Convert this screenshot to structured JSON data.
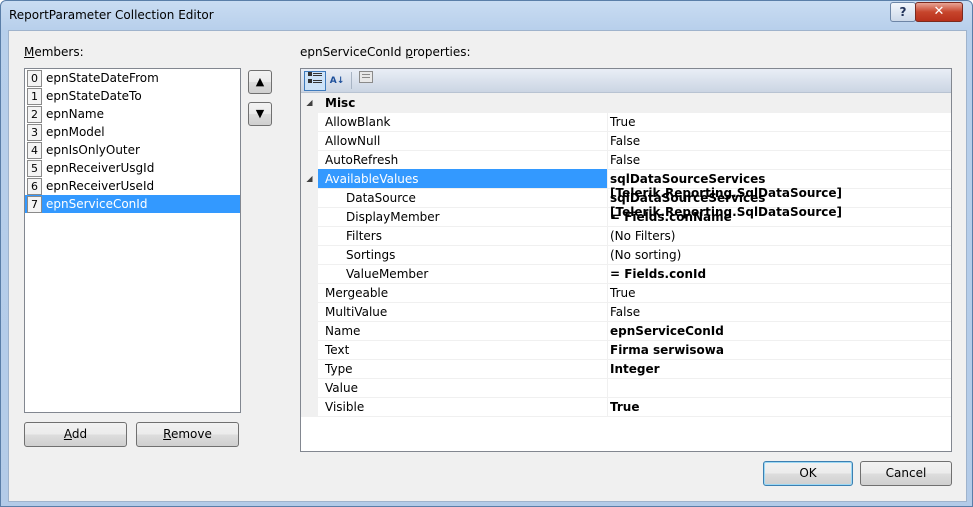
{
  "window": {
    "title": "ReportParameter Collection Editor",
    "help_glyph": "?",
    "close_glyph": "✕"
  },
  "members": {
    "label_prefix": "",
    "label_accel": "M",
    "label_rest": "embers:",
    "items": [
      {
        "index": "0",
        "name": "epnStateDateFrom",
        "selected": false
      },
      {
        "index": "1",
        "name": "epnStateDateTo",
        "selected": false
      },
      {
        "index": "2",
        "name": "epnName",
        "selected": false
      },
      {
        "index": "3",
        "name": "epnModel",
        "selected": false
      },
      {
        "index": "4",
        "name": "epnIsOnlyOuter",
        "selected": false
      },
      {
        "index": "5",
        "name": "epnReceiverUsgId",
        "selected": false
      },
      {
        "index": "6",
        "name": "epnReceiverUseId",
        "selected": false
      },
      {
        "index": "7",
        "name": "epnServiceConId",
        "selected": true
      }
    ],
    "move_up_glyph": "🠅",
    "move_down_glyph": "🠇"
  },
  "buttons": {
    "add_accel": "A",
    "add_rest": "dd",
    "remove_accel": "R",
    "remove_rest": "emove",
    "ok": "OK",
    "cancel": "Cancel"
  },
  "properties": {
    "label_name": "epnServiceConId",
    "label_accel": "p",
    "label_rest": "roperties:",
    "toolbar": {
      "categorized_icon": "categorized-icon",
      "alphabetical_icon": "alphabetical-icon",
      "property_pages_icon": "property-pages-icon"
    },
    "rows": [
      {
        "type": "category",
        "name": "Misc",
        "expander": "◢"
      },
      {
        "type": "prop",
        "name": "AllowBlank",
        "value": "True",
        "bold": false
      },
      {
        "type": "prop",
        "name": "AllowNull",
        "value": "False",
        "bold": false
      },
      {
        "type": "prop",
        "name": "AutoRefresh",
        "value": "False",
        "bold": false
      },
      {
        "type": "prop",
        "name": "AvailableValues",
        "value": "sqlDataSourceServices [Telerik.Reporting.SqlDataSource]",
        "bold": true,
        "selected": true,
        "expander": "◢"
      },
      {
        "type": "child",
        "name": "DataSource",
        "value": "sqlDataSourceServices [Telerik.Reporting.SqlDataSource]",
        "bold": true
      },
      {
        "type": "child",
        "name": "DisplayMember",
        "value": "= Fields.conName",
        "bold": true
      },
      {
        "type": "child",
        "name": "Filters",
        "value": "(No Filters)",
        "bold": false
      },
      {
        "type": "child",
        "name": "Sortings",
        "value": "(No sorting)",
        "bold": false
      },
      {
        "type": "child",
        "name": "ValueMember",
        "value": "= Fields.conId",
        "bold": true
      },
      {
        "type": "prop",
        "name": "Mergeable",
        "value": "True",
        "bold": false
      },
      {
        "type": "prop",
        "name": "MultiValue",
        "value": "False",
        "bold": false
      },
      {
        "type": "prop",
        "name": "Name",
        "value": "epnServiceConId",
        "bold": true
      },
      {
        "type": "prop",
        "name": "Text",
        "value": "Firma serwisowa",
        "bold": true
      },
      {
        "type": "prop",
        "name": "Type",
        "value": "Integer",
        "bold": true
      },
      {
        "type": "prop",
        "name": "Value",
        "value": "",
        "bold": false
      },
      {
        "type": "prop",
        "name": "Visible",
        "value": "True",
        "bold": true
      }
    ]
  },
  "colors": {
    "selection": "#3399ff",
    "titlebar": "#b9d1ea"
  }
}
